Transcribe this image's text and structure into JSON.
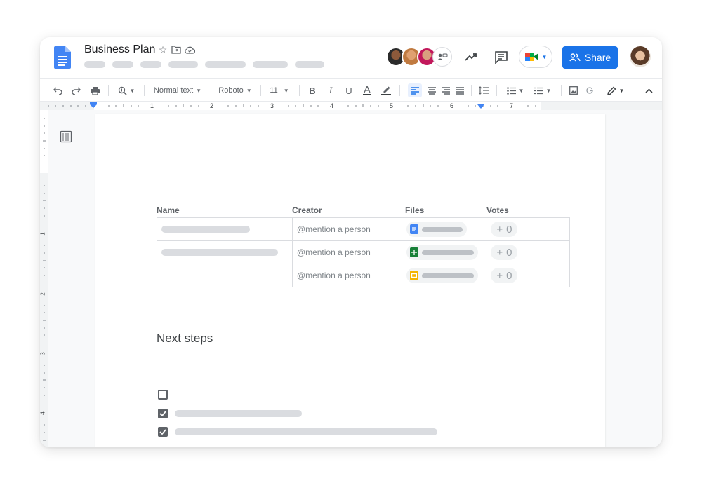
{
  "document": {
    "title": "Business Plan"
  },
  "header": {
    "share_label": "Share",
    "icons": [
      "star-icon",
      "move-to-folder-icon",
      "cloud-saved-icon",
      "trending-icon",
      "comment-icon",
      "meet-icon"
    ]
  },
  "toolbar": {
    "style_label": "Normal text",
    "font_label": "Roboto",
    "font_size": "11"
  },
  "ruler": {
    "numbers": [
      "1",
      "2",
      "3",
      "4",
      "5",
      "6",
      "7"
    ],
    "vertical_numbers": [
      "1",
      "2",
      "3",
      "4"
    ]
  },
  "table": {
    "headers": {
      "name": "Name",
      "creator": "Creator",
      "files": "Files",
      "votes": "Votes"
    },
    "rows": [
      {
        "creator": "@mention a person",
        "file_type": "docs",
        "votes": "0"
      },
      {
        "creator": "@mention a person",
        "file_type": "sheets",
        "votes": "0"
      },
      {
        "creator": "@mention a person",
        "file_type": "slides",
        "votes": "0"
      }
    ]
  },
  "checklist": {
    "title": "Next steps",
    "items": [
      {
        "checked": false
      },
      {
        "checked": true
      },
      {
        "checked": true
      }
    ]
  },
  "colors": {
    "accent": "#1a73e8",
    "docs_blue": "#4285f4",
    "sheets_green": "#188038",
    "slides_yellow": "#f4b400"
  }
}
